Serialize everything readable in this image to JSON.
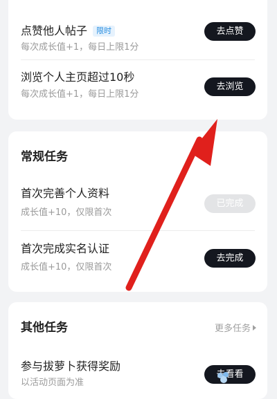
{
  "card1": {
    "tasks": [
      {
        "title": "点赞他人帖子",
        "badge": "限时",
        "subtitle": "每次成长值+1，每日上限1分",
        "button": "去点赞"
      },
      {
        "title": "浏览个人主页超过10秒",
        "subtitle": "每次成长值+1，每日上限1分",
        "button": "去浏览"
      }
    ]
  },
  "regular": {
    "section_title": "常规任务",
    "tasks": [
      {
        "title": "首次完善个人资料",
        "subtitle": "成长值+10，仅限首次",
        "button": "已完成",
        "status": "completed"
      },
      {
        "title": "首次完成实名认证",
        "subtitle": "成长值+10，仅限首次",
        "button": "去完成",
        "status": "pending"
      }
    ]
  },
  "other": {
    "section_title": "其他任务",
    "more_link": "更多任务",
    "tasks": [
      {
        "title": "参与拔萝卜获得奖励",
        "subtitle": "以活动页面为准",
        "button": "去看看"
      }
    ]
  },
  "annotation": {
    "arrow_color": "#e0201c",
    "arrow_icon": "red-arrow-icon"
  },
  "colors": {
    "button_dark": "#14171f",
    "button_disabled": "#e3e4e6",
    "badge_text": "#2a8fe0",
    "badge_bg": "#e6f2fd",
    "page_bg": "#f2f3f5"
  }
}
